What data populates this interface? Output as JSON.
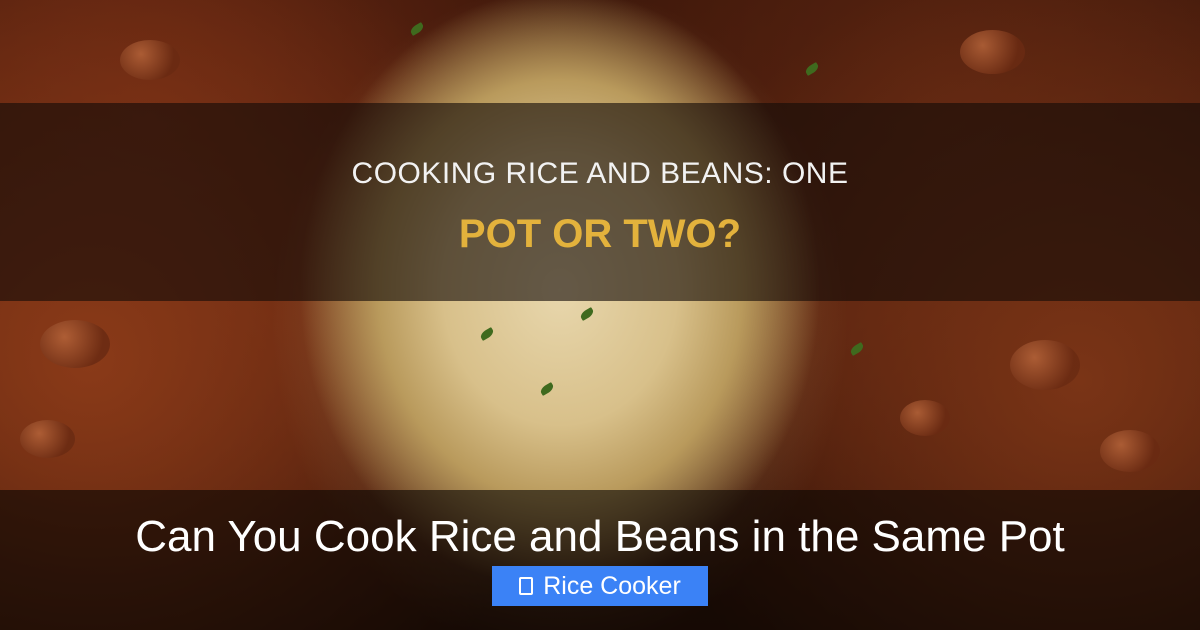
{
  "banner": {
    "headline_line1": "COOKING RICE AND BEANS: ONE",
    "headline_line2": "POT OR TWO?"
  },
  "footer": {
    "title": "Can You Cook Rice and Beans in the Same Pot",
    "category": {
      "icon": "tag-icon",
      "label": "Rice Cooker"
    }
  },
  "colors": {
    "headline_accent": "#e3b23c",
    "badge_bg": "#3b82f6",
    "text": "#ffffff"
  }
}
